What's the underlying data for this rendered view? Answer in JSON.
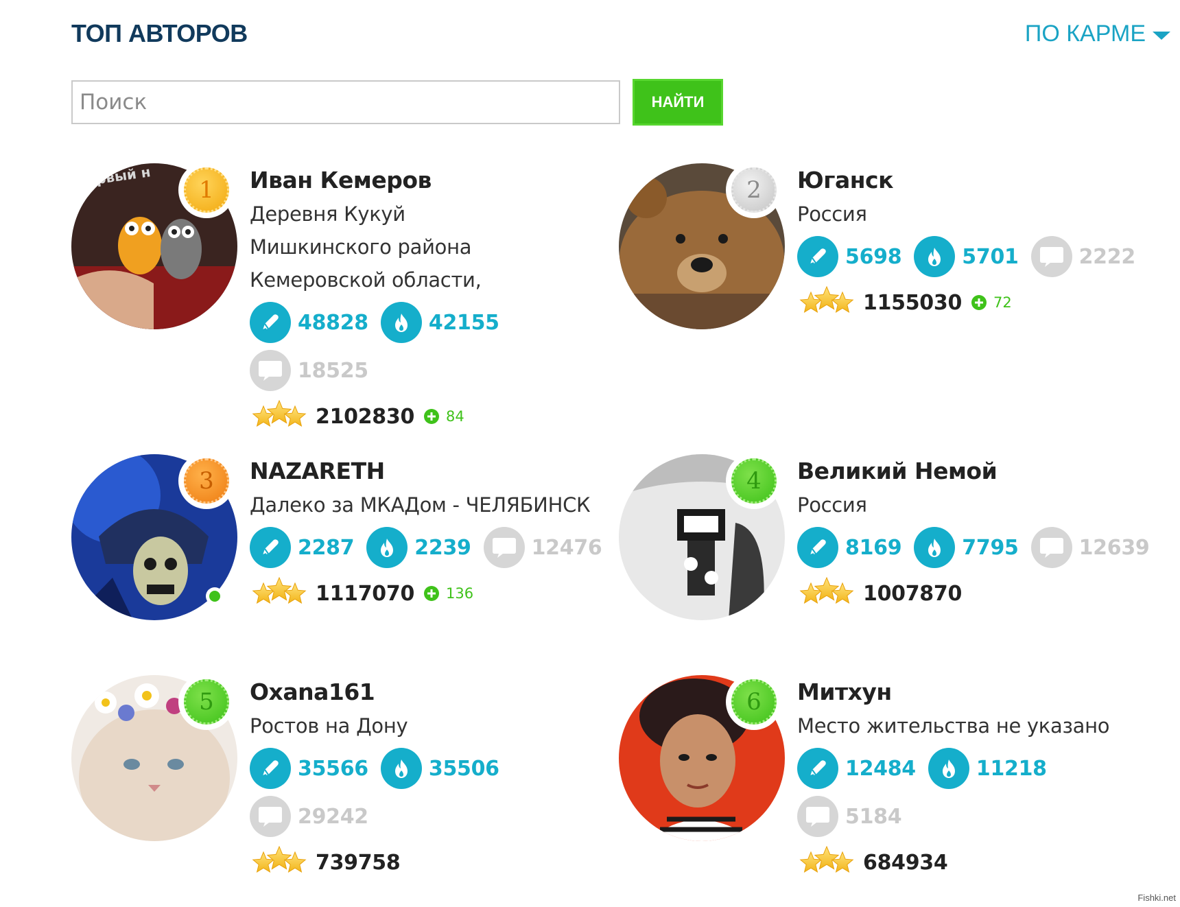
{
  "header": {
    "title": "ТОП АВТОРОВ",
    "sort_label": "ПО КАРМЕ"
  },
  "search": {
    "placeholder": "Поиск",
    "button_label": "НАЙТИ"
  },
  "colors": {
    "accent": "#15aecb",
    "green": "#3fc21a",
    "title": "#113a5c",
    "gold": "#f2b51a",
    "silver": "#c9c9c9",
    "bronze": "#f08a1a"
  },
  "authors": [
    {
      "rank": "1",
      "name": "Иван Кемеров",
      "location": "Деревня Кукуй Мишкинского района Кемеровской области,",
      "posts": "48828",
      "fire": "42155",
      "comments": "18525",
      "karma": "2102830",
      "karma_delta": "84",
      "online": false
    },
    {
      "rank": "2",
      "name": "Юганск",
      "location": "Россия",
      "posts": "5698",
      "fire": "5701",
      "comments": "2222",
      "karma": "1155030",
      "karma_delta": "72",
      "online": false
    },
    {
      "rank": "3",
      "name": "NAZARETH",
      "location": "Далеко за МКАДом - ЧЕЛЯБИНСК",
      "posts": "2287",
      "fire": "2239",
      "comments": "12476",
      "karma": "1117070",
      "karma_delta": "136",
      "online": true
    },
    {
      "rank": "4",
      "name": "Великий Немой",
      "location": "Россия",
      "posts": "8169",
      "fire": "7795",
      "comments": "12639",
      "karma": "1007870",
      "karma_delta": "",
      "online": false
    },
    {
      "rank": "5",
      "name": "Oxana161",
      "location": "Ростов на Дону",
      "posts": "35566",
      "fire": "35506",
      "comments": "29242",
      "karma": "739758",
      "karma_delta": "",
      "online": false
    },
    {
      "rank": "6",
      "name": "Митхун",
      "location": "Место жительства не указано",
      "posts": "12484",
      "fire": "11218",
      "comments": "5184",
      "karma": "684934",
      "karma_delta": "",
      "online": false
    }
  ],
  "avatars": [
    {
      "overlay_text": "первый н"
    },
    {
      "overlay_text": ""
    },
    {
      "overlay_text": ""
    },
    {
      "overlay_text": ""
    },
    {
      "overlay_text": ""
    },
    {
      "overlay_text": ""
    }
  ],
  "watermark": "Fishki.net"
}
